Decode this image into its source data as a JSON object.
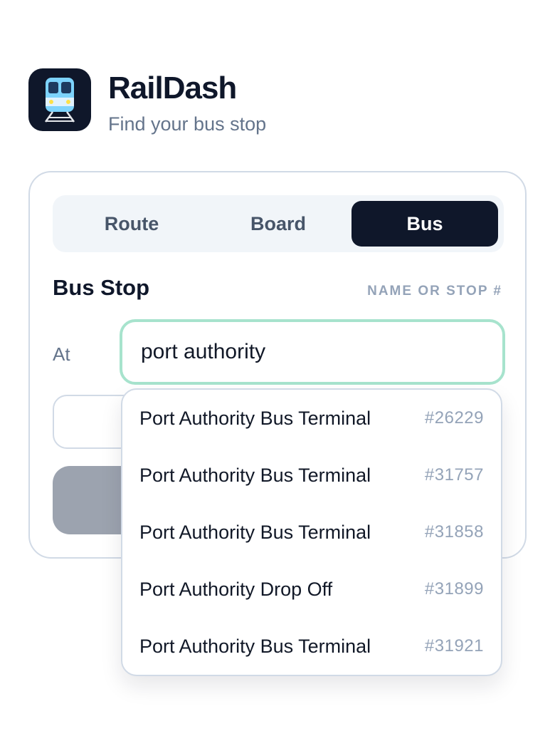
{
  "app": {
    "title": "RailDash",
    "subtitle": "Find your bus stop",
    "logo_icon": "train-icon"
  },
  "tabs": [
    {
      "label": "Route",
      "active": false
    },
    {
      "label": "Board",
      "active": false
    },
    {
      "label": "Bus",
      "active": true
    }
  ],
  "form": {
    "field_label": "Bus Stop",
    "field_hint": "NAME OR STOP #",
    "at_label": "At",
    "search_value": "port authority",
    "locate_icon": "pin-icon"
  },
  "suggestions": [
    {
      "name": "Port Authority Bus Terminal",
      "id": "#26229"
    },
    {
      "name": "Port Authority Bus Terminal",
      "id": "#31757"
    },
    {
      "name": "Port Authority Bus Terminal",
      "id": "#31858"
    },
    {
      "name": "Port Authority Drop Off",
      "id": "#31899"
    },
    {
      "name": "Port Authority Bus Terminal",
      "id": "#31921"
    }
  ],
  "colors": {
    "accent_dark": "#0f172a",
    "input_focus_border": "#a7e3cd",
    "disabled_button": "#9ca3af",
    "muted_text": "#94a3b8"
  }
}
